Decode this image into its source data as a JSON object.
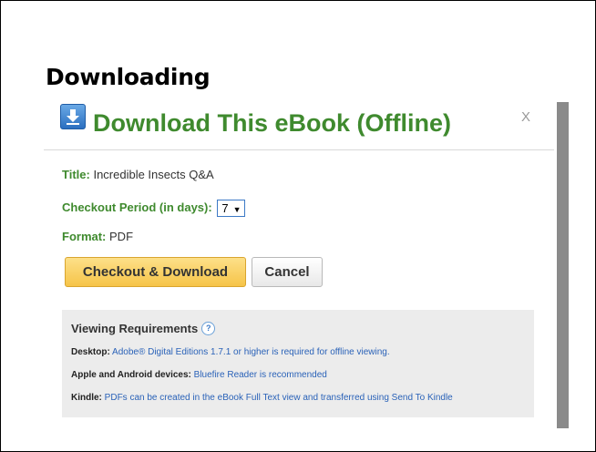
{
  "heading": "Downloading",
  "dialog": {
    "title": "Download This eBook (Offline)",
    "close_label": "X",
    "title_label": "Title:",
    "title_value": "Incredible Insects Q&A",
    "checkout_label": "Checkout Period (in days):",
    "checkout_value": "7",
    "format_label": "Format:",
    "format_value": "PDF",
    "checkout_button": "Checkout & Download",
    "cancel_button": "Cancel"
  },
  "requirements": {
    "heading": "Viewing Requirements",
    "help_symbol": "?",
    "desktop_label": "Desktop:",
    "desktop_link": "Adobe® Digital Editions 1.7.1 or higher is required for offline viewing.",
    "apple_label": "Apple and Android devices:",
    "apple_link": "Bluefire Reader is recommended",
    "kindle_label": "Kindle:",
    "kindle_link": "PDFs can be created in the eBook Full Text view and transferred using Send To Kindle"
  },
  "colors": {
    "title_green": "#3f8a2e",
    "button_yellow": "#f6c448",
    "link_blue": "#2a62b8",
    "panel_gray": "#ececec"
  },
  "icons": [
    "download-icon",
    "help-icon",
    "close-icon",
    "dropdown-arrow-icon"
  ]
}
